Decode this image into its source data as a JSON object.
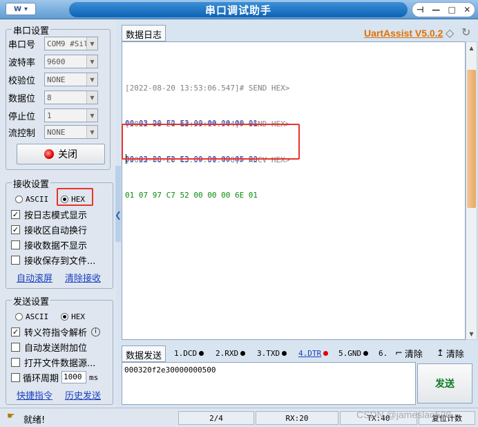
{
  "window": {
    "app_menu_label": "W",
    "title": "串口调试助手",
    "buttons": {
      "pin": "⊣",
      "minimize": "—",
      "maximize": "□",
      "close": "✕"
    }
  },
  "serial_settings": {
    "title": "串口设置",
    "fields": [
      {
        "label": "串口号",
        "value": "COM9 #Sil"
      },
      {
        "label": "波特率",
        "value": "9600"
      },
      {
        "label": "校验位",
        "value": "NONE"
      },
      {
        "label": "数据位",
        "value": "8"
      },
      {
        "label": "停止位",
        "value": "1"
      },
      {
        "label": "流控制",
        "value": "NONE"
      }
    ],
    "close_button": "关闭"
  },
  "receive_settings": {
    "title": "接收设置",
    "radio_ascii": "ASCII",
    "radio_hex": "HEX",
    "selected": "HEX",
    "options": [
      {
        "label": "按日志模式显示",
        "checked": true
      },
      {
        "label": "接收区自动换行",
        "checked": true
      },
      {
        "label": "接收数据不显示",
        "checked": false
      },
      {
        "label": "接收保存到文件...",
        "checked": false
      }
    ],
    "link_autoscroll": "自动滚屏",
    "link_clear": "清除接收"
  },
  "send_settings": {
    "title": "发送设置",
    "radio_ascii": "ASCII",
    "radio_hex": "HEX",
    "selected": "HEX",
    "options": [
      {
        "label": "转义符指令解析",
        "checked": true
      },
      {
        "label": "自动发送附加位",
        "checked": false
      },
      {
        "label": "打开文件数据源...",
        "checked": false
      },
      {
        "label": "循环周期",
        "checked": false
      }
    ],
    "cycle_value": "1000",
    "cycle_unit": "ms",
    "link_shortcut": "快捷指令",
    "link_history": "历史发送"
  },
  "log": {
    "tab_label": "数据日志",
    "brand": "UartAssist V5.0.2",
    "entries": [
      {
        "header": "[2022-08-20 13:53:06.547]# SEND HEX>",
        "data": "00 03 20 F2 E3 00 00 00 00 01",
        "dir": "send"
      },
      {
        "header": "[2022-08-20 13:55:14.944]# SEND HEX>",
        "data": "00 03 20 F2 E3 00 00 00 05 00",
        "dir": "send"
      },
      {
        "header": "[2022-08-20 13:57:51.478]# RECV HEX>",
        "data": "01 07 97 C7 52 00 00 00 6E 01",
        "dir": "recv"
      }
    ]
  },
  "send_area": {
    "tab_label": "数据发送",
    "signals": [
      {
        "label": "1.DCD",
        "active": false
      },
      {
        "label": "2.RXD",
        "active": false
      },
      {
        "label": "3.TXD",
        "active": false
      },
      {
        "label": "4.DTR",
        "active": true
      },
      {
        "label": "5.GND",
        "active": false
      },
      {
        "label": "6.",
        "active": false
      }
    ],
    "clear_label_1": "清除",
    "clear_label_2": "清除",
    "input_value": "000320f2e30000000500",
    "send_button": "发送"
  },
  "status": {
    "ready": "就绪!",
    "page": "2/4",
    "rx": "RX:20",
    "tx": "TX:40",
    "reset": "复位计数"
  },
  "watermark": "CSDN @jameslao520",
  "colors": {
    "send_data": "#1a2fd6",
    "recv_data": "#078a07",
    "timestamp": "#808080",
    "highlight": "#e8322a"
  }
}
